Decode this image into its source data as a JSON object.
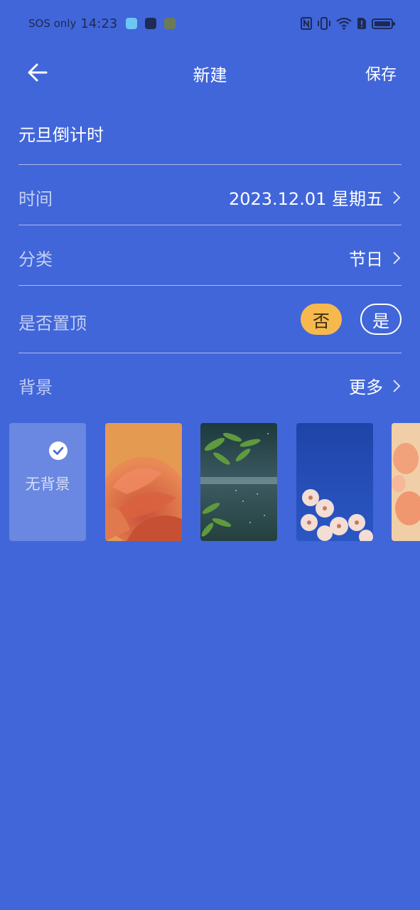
{
  "status_bar": {
    "carrier": "SOS only",
    "time": "14:23"
  },
  "header": {
    "title": "新建",
    "save_label": "保存"
  },
  "event_name": "元旦倒计时",
  "rows": {
    "time": {
      "label": "时间",
      "value": "2023.12.01 星期五"
    },
    "category": {
      "label": "分类",
      "value": "节日"
    },
    "pin": {
      "label": "是否置顶",
      "option_no": "否",
      "option_yes": "是",
      "selected": "否"
    },
    "background": {
      "label": "背景",
      "more": "更多"
    }
  },
  "backgrounds": [
    {
      "label": "无背景",
      "selected": true
    },
    {
      "name": "orange-rose"
    },
    {
      "name": "green-leaves-rain"
    },
    {
      "name": "white-blossoms-blue"
    },
    {
      "name": "peach-flowers"
    }
  ],
  "colors": {
    "page_bg": "#4166D9",
    "accent_selected": "#F5B94E"
  }
}
